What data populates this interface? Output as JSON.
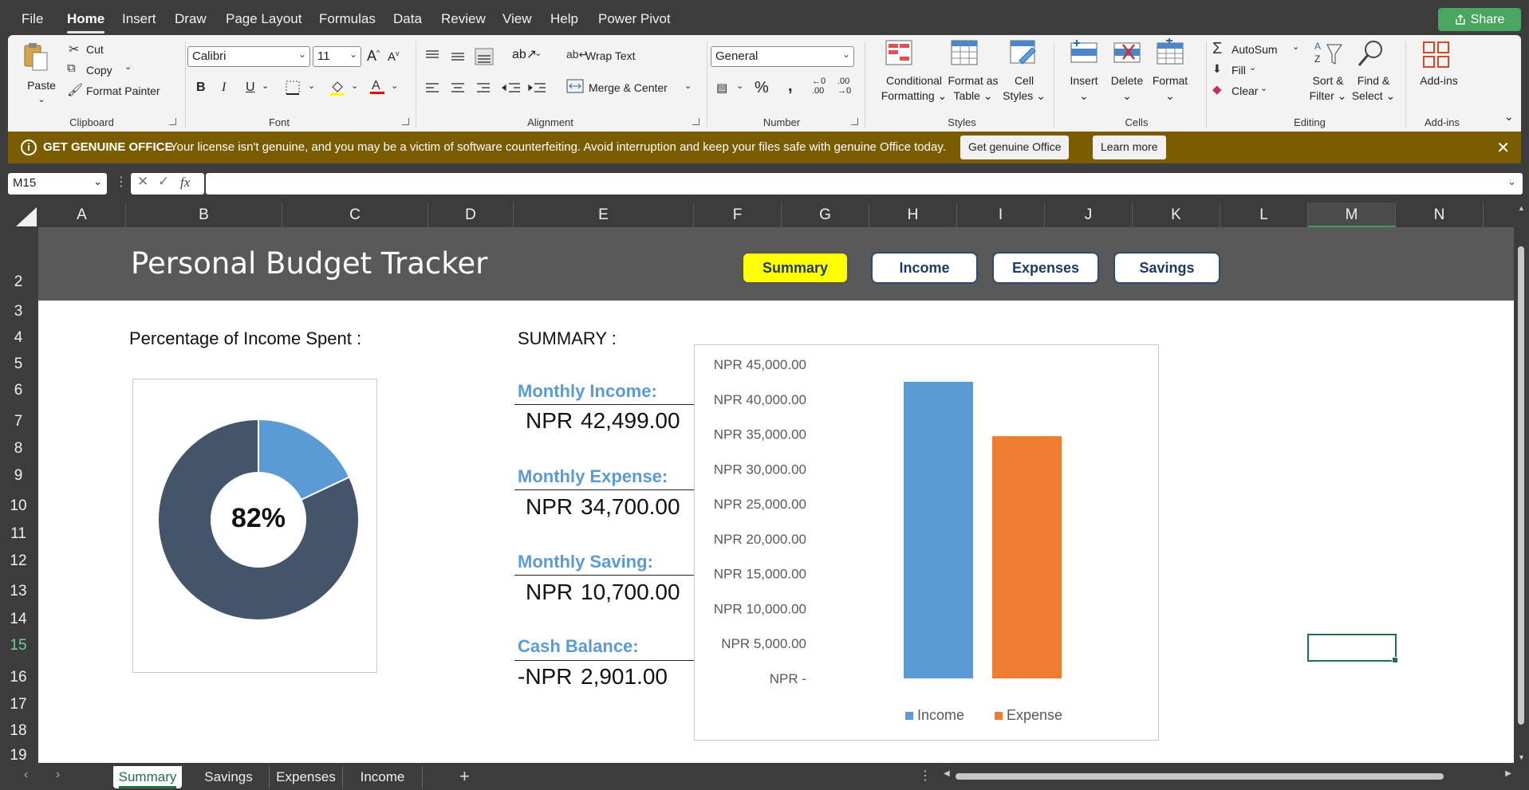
{
  "menu": {
    "tabs": [
      "File",
      "Home",
      "Insert",
      "Draw",
      "Page Layout",
      "Formulas",
      "Data",
      "Review",
      "View",
      "Help",
      "Power Pivot"
    ],
    "active": "Home",
    "share_label": "Share"
  },
  "ribbon": {
    "clipboard": {
      "paste": "Paste",
      "cut": "Cut",
      "copy": "Copy",
      "format_painter": "Format Painter",
      "label": "Clipboard"
    },
    "font": {
      "name": "Calibri",
      "size": "11",
      "label": "Font",
      "bold": "B",
      "italic": "I",
      "underline": "U"
    },
    "alignment": {
      "wrap_text": "Wrap Text",
      "merge_center": "Merge & Center",
      "label": "Alignment"
    },
    "number": {
      "format": "General",
      "label": "Number"
    },
    "styles": {
      "conditional": "Conditional",
      "conditional2": "Formatting",
      "format_as": "Format as",
      "format_as2": "Table",
      "cell": "Cell",
      "cell2": "Styles",
      "label": "Styles"
    },
    "cells": {
      "insert": "Insert",
      "delete": "Delete",
      "format": "Format",
      "label": "Cells"
    },
    "editing": {
      "autosum": "AutoSum",
      "fill": "Fill",
      "clear": "Clear",
      "sort": "Sort &",
      "sort2": "Filter",
      "find": "Find &",
      "find2": "Select",
      "label": "Editing"
    },
    "addins": {
      "addins": "Add-ins",
      "label": "Add-ins"
    }
  },
  "genuine_bar": {
    "title": "GET GENUINE OFFICE",
    "message": "Your license isn't genuine, and you may be a victim of software counterfeiting. Avoid interruption and keep your files safe with genuine Office today.",
    "button": "Get genuine Office",
    "learn_more": "Learn more"
  },
  "formula_bar": {
    "name_box": "M15",
    "fx": "fx",
    "formula": ""
  },
  "columns": [
    "A",
    "B",
    "C",
    "D",
    "E",
    "F",
    "G",
    "H",
    "I",
    "J",
    "K",
    "L",
    "M",
    "N"
  ],
  "selected_column": "M",
  "rows": [
    "2",
    "3",
    "4",
    "5",
    "6",
    "7",
    "8",
    "9",
    "10",
    "11",
    "12",
    "13",
    "14",
    "15",
    "16",
    "17",
    "18",
    "19"
  ],
  "selected_row": "15",
  "sheet": {
    "title": "Personal Budget Tracker",
    "nav_buttons": [
      "Summary",
      "Income",
      "Expenses",
      "Savings"
    ],
    "active_nav": "Summary",
    "pct_label": "Percentage of Income Spent :",
    "pct_value": "82%",
    "summary_label": "SUMMARY :",
    "metrics": [
      {
        "label": "Monthly Income:",
        "currency": "NPR",
        "amount": "42,499.00"
      },
      {
        "label": "Monthly Expense:",
        "currency": "NPR",
        "amount": "34,700.00"
      },
      {
        "label": "Monthly Saving:",
        "currency": "NPR",
        "amount": "10,700.00"
      },
      {
        "label": "Cash Balance:",
        "currency": "-NPR",
        "amount": "2,901.00"
      }
    ]
  },
  "donut": {
    "spent_fraction": 0.82,
    "colors": {
      "spent": "#44546a",
      "remaining": "#5b9bd5"
    }
  },
  "chart_data": {
    "type": "bar",
    "categories": [
      "Income",
      "Expense"
    ],
    "values": [
      42499,
      34700
    ],
    "colors": [
      "#5b9bd5",
      "#ed7d31"
    ],
    "ylim": [
      0,
      45000
    ],
    "y_ticks": [
      "NPR 45,000.00",
      "NPR 40,000.00",
      "NPR 35,000.00",
      "NPR 30,000.00",
      "NPR 25,000.00",
      "NPR 20,000.00",
      "NPR 15,000.00",
      "NPR 10,000.00",
      "NPR 5,000.00",
      "NPR -"
    ],
    "legend": [
      "Income",
      "Expense"
    ],
    "legend_position": "bottom",
    "title": "",
    "xlabel": "",
    "ylabel": ""
  },
  "sheet_tabs": [
    "Summary",
    "Savings",
    "Expenses",
    "Income"
  ],
  "active_sheet": "Summary"
}
